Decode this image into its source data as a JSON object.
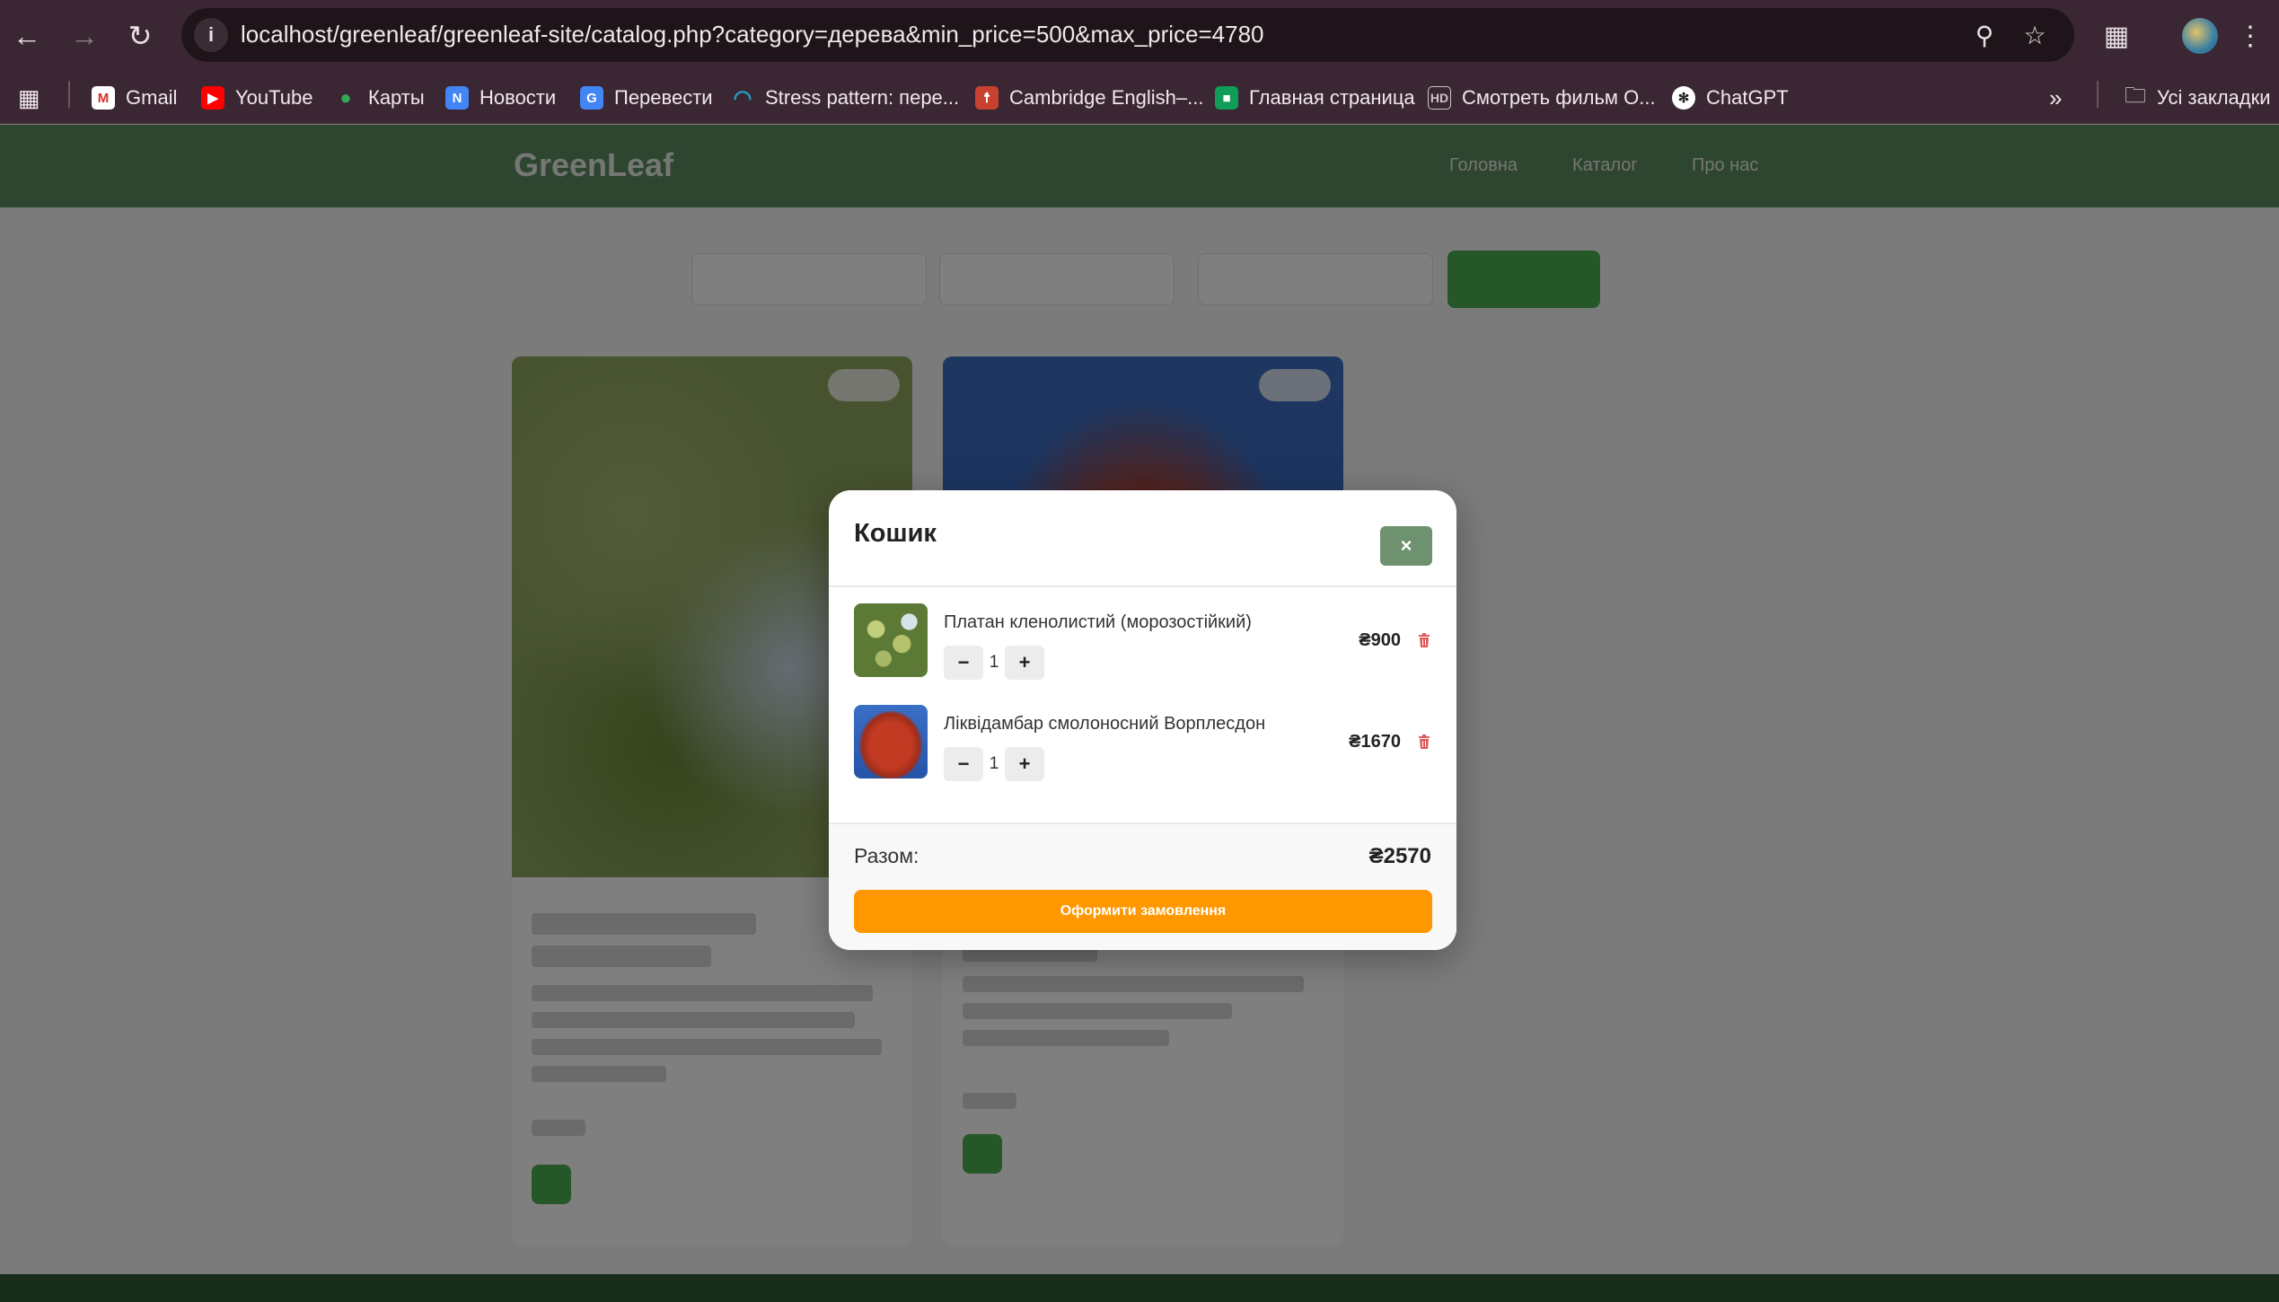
{
  "browser": {
    "url": "localhost/greenleaf/greenleaf-site/catalog.php?category=дерева&min_price=500&max_price=4780",
    "bookmarks": [
      {
        "label": "Gmail",
        "icon": "gmail-icon",
        "color": "#d93025"
      },
      {
        "label": "YouTube",
        "icon": "youtube-icon",
        "color": "#ff0000"
      },
      {
        "label": "Карты",
        "icon": "maps-icon",
        "color": "#34a853"
      },
      {
        "label": "Новости",
        "icon": "news-icon",
        "color": "#4285f4"
      },
      {
        "label": "Перевести",
        "icon": "translate-icon",
        "color": "#4285f4"
      },
      {
        "label": "Stress pattern: пере...",
        "icon": "stress-icon",
        "color": "#1fa3c9"
      },
      {
        "label": "Cambridge English–...",
        "icon": "cambridge-icon",
        "color": "#c8412e"
      },
      {
        "label": "Главная страница",
        "icon": "classroom-icon",
        "color": "#0f9d58"
      },
      {
        "label": "Смотреть фильм О...",
        "icon": "hd-icon",
        "color": "#6b5560"
      },
      {
        "label": "ChatGPT",
        "icon": "chatgpt-icon",
        "color": "#ffffff"
      }
    ],
    "all_bookmarks_label": "Усі закладки"
  },
  "site": {
    "logo": "GreenLeaf",
    "nav": [
      "Головна",
      "Каталог",
      "Про нас"
    ]
  },
  "cart": {
    "title": "Кошик",
    "close_label": "×",
    "items": [
      {
        "name": "Платан кленолистий (морозостійкий)",
        "qty": "1",
        "price": "₴900"
      },
      {
        "name": "Ліквідамбар смолоносний Ворплесдон",
        "qty": "1",
        "price": "₴1670"
      }
    ],
    "minus_label": "−",
    "plus_label": "+",
    "trash_icon": "trash-icon",
    "total_label": "Разом:",
    "total_value": "₴2570",
    "checkout_label": "Оформити замовлення"
  },
  "colors": {
    "header_green": "#5c8a5e",
    "close_button": "#6e9270",
    "checkout_orange": "#ff9800",
    "trash_red": "#e05a5a"
  }
}
